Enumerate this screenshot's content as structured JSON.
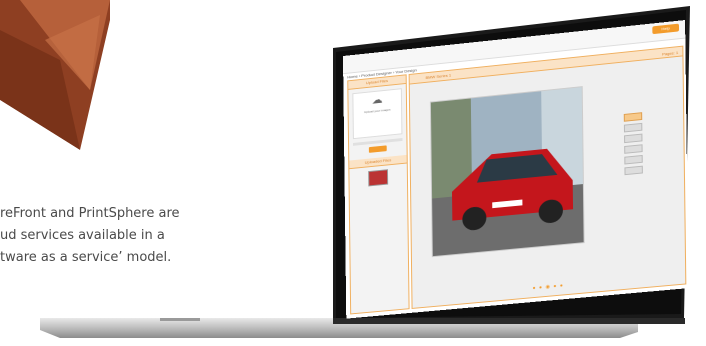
{
  "intro": {
    "line1": "reFront and PrintSphere are",
    "line2": "ud services available in a",
    "line3": "tware as a service’ model."
  },
  "colors": {
    "accent": "#f39c2c",
    "panel_header": "#fbe3c6",
    "deco_brown": "#9a4a28",
    "laptop_bezel": "#1a1a1a",
    "laptop_body": "#cfcfcf"
  },
  "screen": {
    "help_button": "Help",
    "breadcrumb": "Home › Product Designer › Your Design",
    "left_panel": {
      "upload_header": "Upload Files",
      "upload_text": "Upload your images",
      "upload_icon": "cloud-upload-icon",
      "uploaded_header": "Uploaded Files"
    },
    "main": {
      "header": "BMW Series 1",
      "pages_label": "Pages: 1"
    }
  }
}
